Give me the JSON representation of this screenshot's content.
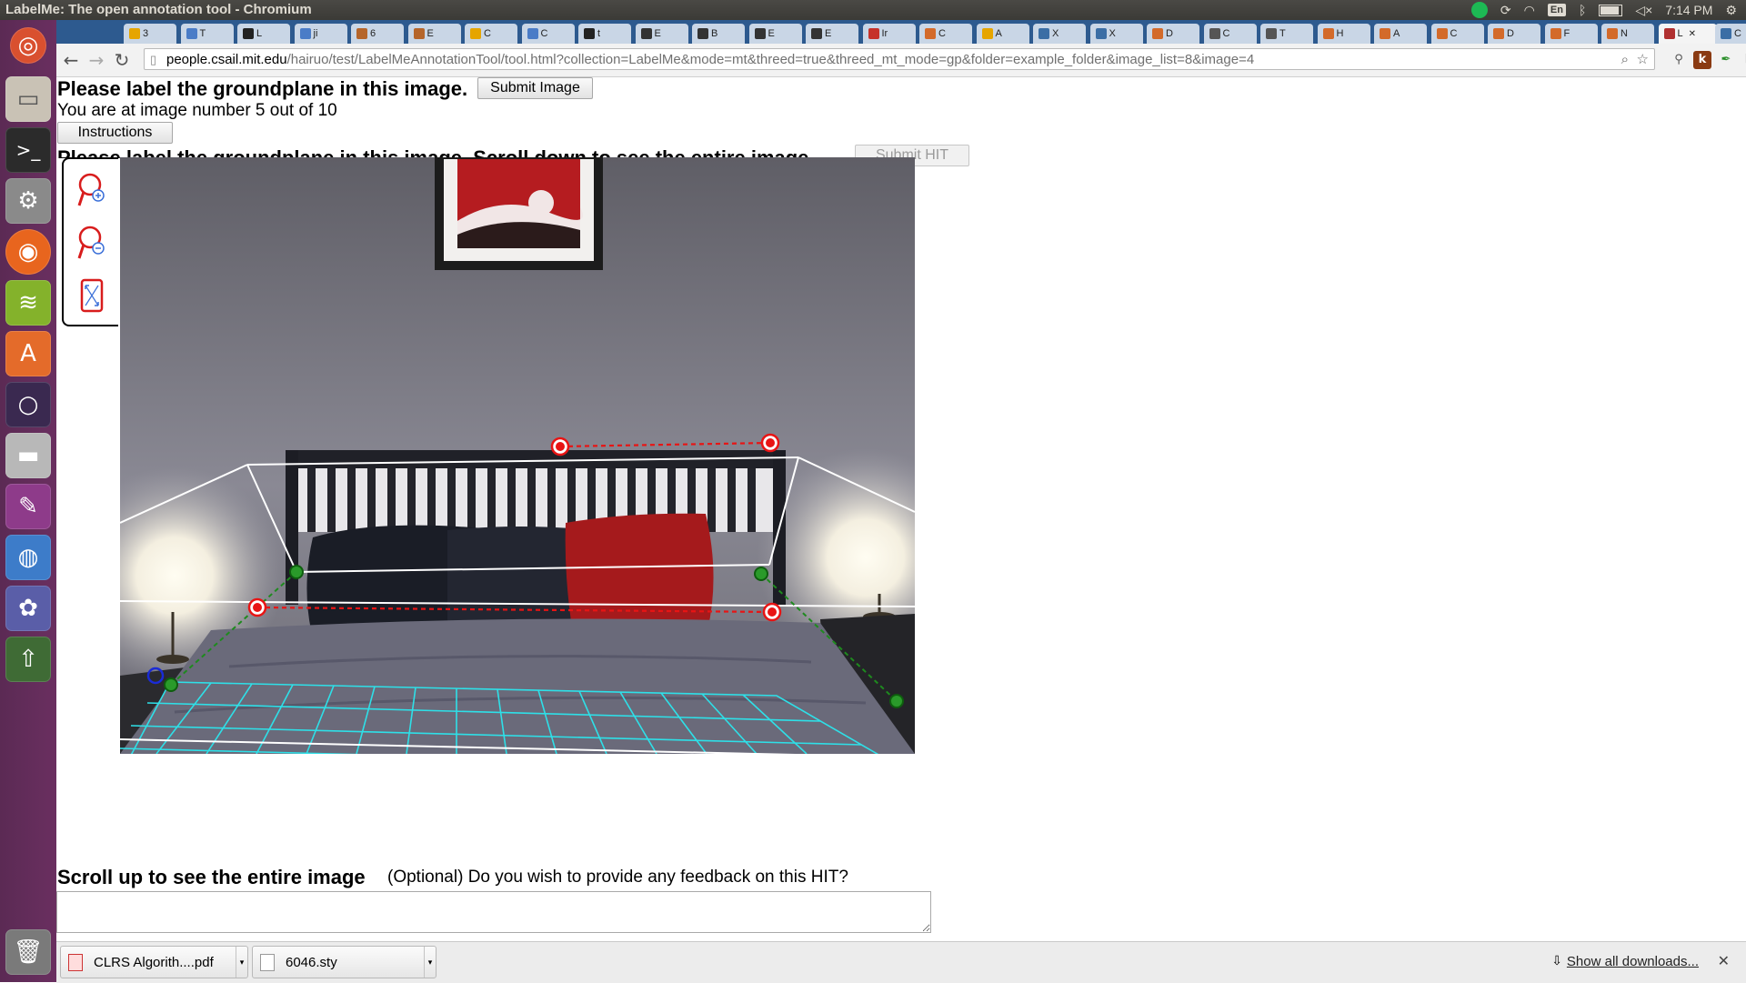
{
  "window": {
    "title": "LabelMe: The open annotation tool - Chromium"
  },
  "system": {
    "language": "En",
    "clock": "7:14 PM"
  },
  "tabs": [
    {
      "label": "3",
      "color": "#e6a500"
    },
    {
      "label": "T",
      "color": "#4a7cc7"
    },
    {
      "label": "L",
      "color": "#222222"
    },
    {
      "label": "ji",
      "color": "#4a7cc7"
    },
    {
      "label": "6",
      "color": "#b5652a"
    },
    {
      "label": "E",
      "color": "#b5652a"
    },
    {
      "label": "C",
      "color": "#e6a500"
    },
    {
      "label": "C",
      "color": "#4a7cc7"
    },
    {
      "label": "t",
      "color": "#222222"
    },
    {
      "label": "E",
      "color": "#333333"
    },
    {
      "label": "B",
      "color": "#333333"
    },
    {
      "label": "E",
      "color": "#333333"
    },
    {
      "label": "E",
      "color": "#333333"
    },
    {
      "label": "Ir",
      "color": "#c6322a"
    },
    {
      "label": "C",
      "color": "#d36a2a"
    },
    {
      "label": "A",
      "color": "#e6a500"
    },
    {
      "label": "X",
      "color": "#3b6ea5"
    },
    {
      "label": "X",
      "color": "#3b6ea5"
    },
    {
      "label": "D",
      "color": "#d36a2a"
    },
    {
      "label": "C",
      "color": "#555555"
    },
    {
      "label": "T",
      "color": "#555555"
    },
    {
      "label": "H",
      "color": "#d36a2a"
    },
    {
      "label": "A",
      "color": "#d36a2a"
    },
    {
      "label": "C",
      "color": "#d36a2a"
    },
    {
      "label": "D",
      "color": "#d36a2a"
    },
    {
      "label": "F",
      "color": "#d36a2a"
    },
    {
      "label": "N",
      "color": "#d36a2a"
    },
    {
      "label": "L",
      "color": "#b03030",
      "active": true
    },
    {
      "label": "C",
      "color": "#3b6ea5"
    }
  ],
  "omnibox": {
    "host": "people.csail.mit.edu",
    "path": "/hairuo/test/LabelMeAnnotationTool/tool.html?collection=LabelMe&mode=mt&threed=true&threed_mt_mode=gp&folder=example_folder&image_list=8&image=4"
  },
  "page": {
    "heading": "Please label the groundplane in this image.",
    "submit_image_label": "Submit Image",
    "progress_text": "You are at image number 5 out of 10",
    "instructions_label": "Instructions",
    "hidden_heading": "Please label the groundplane in this image. Scroll down to see the entire image.",
    "submit_hit_label": "Submit HIT",
    "scroll_up_text": "Scroll up to see the entire image",
    "feedback_prompt": "(Optional) Do you wish to provide any feedback on this HIT?"
  },
  "tools": [
    {
      "name": "zoom-in"
    },
    {
      "name": "zoom-out"
    },
    {
      "name": "fit-image"
    }
  ],
  "downloads": [
    {
      "filename": "CLRS Algorith....pdf",
      "type": "pdf"
    },
    {
      "filename": "6046.sty",
      "type": "file"
    }
  ],
  "shelf": {
    "show_all_label": "Show all downloads..."
  },
  "colors": {
    "annotation_red": "#e81414",
    "annotation_green": "#1e8a1e",
    "annotation_blue": "#1a2bd6",
    "groundplane_grid": "#2ee0e8",
    "launcher_bg": "#5b2a54",
    "tabstrip_bg": "#2d5a8f"
  }
}
